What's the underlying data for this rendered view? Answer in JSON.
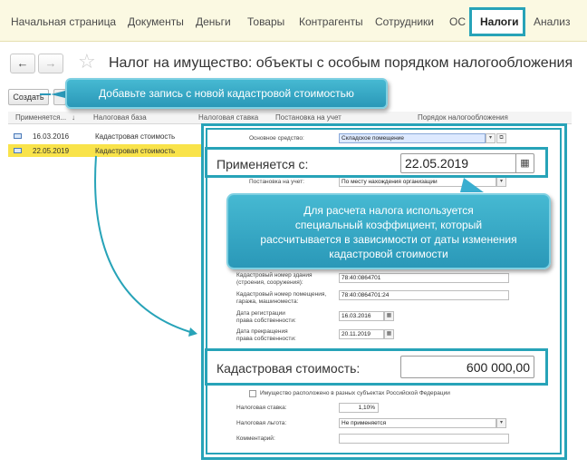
{
  "nav": {
    "items": [
      "Начальная страница",
      "Документы",
      "Деньги",
      "Товары",
      "Контрагенты",
      "Сотрудники",
      "ОС",
      "Налоги",
      "Анализ"
    ],
    "active": "Налоги"
  },
  "title_bar": {
    "back_icon": "arrow-left-icon",
    "forward_icon": "arrow-right-icon",
    "favorite_icon": "star-icon",
    "title": "Налог на имущество: объекты с особым порядком налогообложения"
  },
  "toolbar": {
    "create_label": "Создать"
  },
  "callouts": {
    "add_record": "Добавьте запись с новой кадастровой стоимостью",
    "coefficient": [
      "Для расчета налога используется",
      "специальный коэффициент, который",
      "рассчитывается в зависимости от даты изменения",
      "кадастровой стоимости"
    ]
  },
  "list": {
    "columns": [
      "Применяется...",
      "Налоговая база",
      "Налоговая ставка",
      "Постановка на учет",
      "Порядок налогообложения"
    ],
    "sort_icon": "↓",
    "rows": [
      {
        "date": "16.03.2016",
        "base": "Кадастровая стоимость",
        "selected": false
      },
      {
        "date": "22.05.2019",
        "base": "Кадастровая стоимость",
        "selected": true
      }
    ]
  },
  "form": {
    "asset_label": "Основное средство:",
    "asset_value": "Складское помещение",
    "registration_label": "Постановка на учет:",
    "registration_value": "По месту нахождения организации",
    "building_number_label": [
      "Кадастровый номер здания",
      "(строения, сооружения):"
    ],
    "building_number_value": "78:40:0864701",
    "room_number_label": [
      "Кадастровый номер помещения,",
      "гаража, машиноместа:"
    ],
    "room_number_value": "78:40:0864701:24",
    "ownership_reg_label": [
      "Дата регистрации",
      "права собственности:"
    ],
    "ownership_reg_value": "16.03.2016",
    "ownership_end_label": [
      "Дата прекращения",
      "права собственности:"
    ],
    "ownership_end_value": "20.11.2019",
    "multi_region_label": "Имущество расположено в разных субъектах Российской Федерации",
    "tax_rate_label": "Налоговая ставка:",
    "tax_rate_value": "1,10%",
    "tax_benefit_label": "Налоговая льгота:",
    "tax_benefit_value": "Не применяется",
    "comment_label": "Комментарий:",
    "comment_value": ""
  },
  "zoom": {
    "applies_label": "Применяется с:",
    "applies_value": "22.05.2019",
    "calendar_icon": "calendar-icon",
    "cadastral_label": "Кадастровая стоимость:",
    "cadastral_value": "600 000,00"
  },
  "colors": {
    "accent": "#27a3b8",
    "selection": "#f9e34a",
    "nav_bg": "#fbf9e2"
  }
}
